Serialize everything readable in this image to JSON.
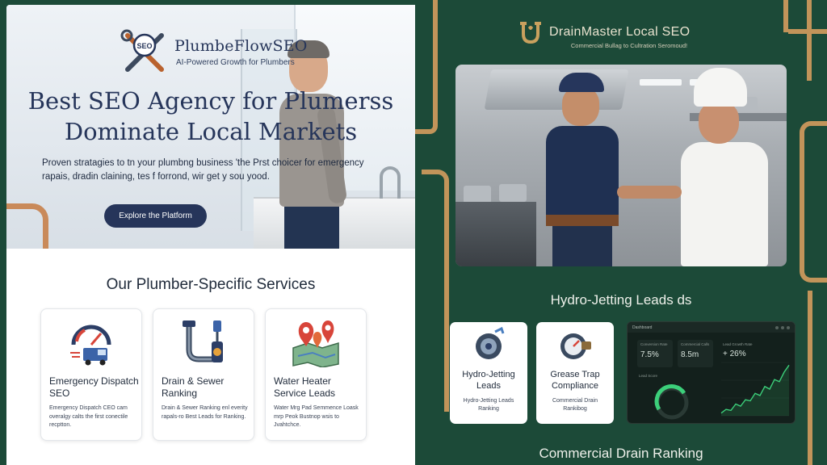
{
  "left_panel": {
    "brand": {
      "name": "PlumbeFlowSEO",
      "logo_text": "SEO",
      "tagline": "AI-Powered Growth for Plumbers"
    },
    "hero": {
      "title_line1": "Best SEO Agency for Plumerss",
      "title_line2": "Dominate Local Markets",
      "subtitle": "Proven stratagies to tn your plumbng business 'the Prst choicer for emergency rapais, dradin claining, tes f forrond, wir get y sou yood.",
      "cta_label": "Explore the Platform"
    },
    "services": {
      "heading": "Our Plumber-Specific Services",
      "cards": [
        {
          "title": "Emergency Dispatch SEO",
          "description": "Emergency Dispatch CEO cam overalgy calts the first conectile recptton.",
          "icon": "emergency-van-gauge-icon"
        },
        {
          "title": "Drain & Sewer Ranking",
          "description": "Drain & Sewer Ranking enl everity rapals-ro Best Leads for Ranking.",
          "icon": "drain-pipe-icon"
        },
        {
          "title": "Water Heater Service Leads",
          "description": "Water Mrg Pad Semmence Loask mrp Peok Bustnop wsis to Jvahtchce.",
          "icon": "map-pins-icon"
        }
      ]
    }
  },
  "right_panel": {
    "brand": {
      "name": "DrainMaster Local SEO",
      "tagline": "Commercial Bullag to Cultration Seromoud!",
      "icon": "u-trap-pipe-icon"
    },
    "hydro_heading": "Hydro-Jetting Leads ds",
    "feature_cards": [
      {
        "title": "Hydro-Jetting Leads",
        "description": "Hydro-Jetting Leads Ranking",
        "icon": "hose-reel-icon"
      },
      {
        "title": "Grease Trap Compliance",
        "description": "Commercial Drain Rankibog",
        "icon": "grease-trap-gauge-icon"
      }
    ],
    "dashboard": {
      "title": "Dashboard",
      "kpis": [
        {
          "label": "Conversion Rate",
          "value": "7.5%"
        },
        {
          "label": "Commercial Calls",
          "value": "8.5m"
        }
      ],
      "growth": {
        "label": "Lead Growth Rate",
        "value": "+ 26%"
      },
      "gauge_label": "Lead Score",
      "chart_points": [
        0.05,
        0.12,
        0.1,
        0.22,
        0.18,
        0.3,
        0.28,
        0.42,
        0.38,
        0.55,
        0.5,
        0.68,
        0.64,
        0.82,
        0.95
      ],
      "accent_color": "#3ccf7a"
    },
    "commercial_heading": "Commercial Drain Ranking"
  }
}
